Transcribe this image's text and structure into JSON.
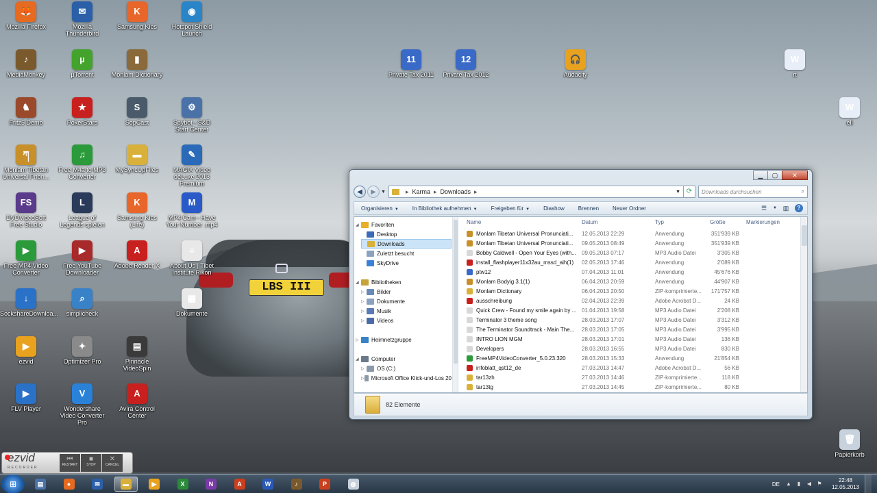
{
  "desktop": {
    "icons": [
      {
        "label": "Mozilla Firefox",
        "icon": "firefox-icon",
        "color": "#e66a1f",
        "glyph": "🦊"
      },
      {
        "label": "Mozilla Thunderbird",
        "icon": "thunderbird-icon",
        "color": "#2b5fa8",
        "glyph": "✉"
      },
      {
        "label": "Samsung Kies",
        "icon": "samsung-kies-icon",
        "color": "#e8662a",
        "glyph": "K"
      },
      {
        "label": "Hotspot Shield Launch",
        "icon": "hotspot-shield-icon",
        "color": "#2a84c8",
        "glyph": "◉"
      },
      {
        "label": "MediaMonkey",
        "icon": "mediamonkey-icon",
        "color": "#7a5a2c",
        "glyph": "♪"
      },
      {
        "label": "µTorrent",
        "icon": "utorrent-icon",
        "color": "#44a32c",
        "glyph": "µ"
      },
      {
        "label": "Monlam Dictionary",
        "icon": "monlam-dictionary-icon",
        "color": "#8a6a3a",
        "glyph": "▮"
      },
      {
        "label": "Fritz5 Demo",
        "icon": "fritz-icon",
        "color": "#9a4a2a",
        "glyph": "♞"
      },
      {
        "label": "PokerStars",
        "icon": "pokerstars-icon",
        "color": "#c8201e",
        "glyph": "★"
      },
      {
        "label": "SopCast",
        "icon": "sopcast-icon",
        "color": "#4a5a6a",
        "glyph": "S"
      },
      {
        "label": "Spybot - S&D Start Center",
        "icon": "spybot-icon",
        "color": "#4a72a8",
        "glyph": "⚙"
      },
      {
        "label": "Monlam Tibetan Universal Phon...",
        "icon": "monlam-tibetan-icon",
        "color": "#c8902a",
        "glyph": "ཀ"
      },
      {
        "label": "Free M4a to MP3 Converter",
        "icon": "m4a-converter-icon",
        "color": "#2a9a3a",
        "glyph": "♫"
      },
      {
        "label": "MySyncUpFiles",
        "icon": "folder-icon",
        "color": "#d9b13a",
        "glyph": "▬"
      },
      {
        "label": "MAGIX Video deLuxe 2013 Premium",
        "icon": "magix-icon",
        "color": "#2a6ab8",
        "glyph": "✎"
      },
      {
        "label": "DVDVideoSoft Free Studio",
        "icon": "dvdvideosoft-icon",
        "color": "#5a3a8a",
        "glyph": "FS"
      },
      {
        "label": "League of Legends spielen",
        "icon": "lol-icon",
        "color": "#2a3a5a",
        "glyph": "L"
      },
      {
        "label": "Samsung Kies (Lite)",
        "icon": "samsung-kies-lite-icon",
        "color": "#e8662a",
        "glyph": "K"
      },
      {
        "label": "MP4 Cam - Have Your Number .mp4",
        "icon": "mp4-file-icon",
        "color": "#2a5ac8",
        "glyph": "M"
      },
      {
        "label": "Free MP4 Video Converter",
        "icon": "mp4-converter-icon",
        "color": "#2a9a3a",
        "glyph": "▶"
      },
      {
        "label": "Free YouTube Downloader",
        "icon": "youtube-downloader-icon",
        "color": "#a82a2a",
        "glyph": "▶"
      },
      {
        "label": "Adobe Reader X",
        "icon": "adobe-reader-icon",
        "color": "#c8201e",
        "glyph": "A"
      },
      {
        "label": "About Us | Tibet Institute Rikon",
        "icon": "document-icon",
        "color": "#e8e8e8",
        "glyph": "≡"
      },
      {
        "label": "SockshareDownloa...",
        "icon": "sockshare-icon",
        "color": "#2a72c8",
        "glyph": "↓"
      },
      {
        "label": "simplicheck",
        "icon": "simplicheck-icon",
        "color": "#3a82c8",
        "glyph": "⌕"
      },
      {
        "label": "Dokumente",
        "icon": "dokumente-icon",
        "color": "#e8e8e8",
        "glyph": "▦"
      },
      {
        "label": "ezvid",
        "icon": "ezvid-icon",
        "color": "#e8a21e",
        "glyph": "▶"
      },
      {
        "label": "Optimizer Pro",
        "icon": "optimizer-icon",
        "color": "#8a8a8a",
        "glyph": "✦"
      },
      {
        "label": "Pinnacle VideoSpin",
        "icon": "pinnacle-icon",
        "color": "#3a3a3a",
        "glyph": "▤"
      },
      {
        "label": "FLV Player",
        "icon": "flv-player-icon",
        "color": "#2a72c8",
        "glyph": "▶"
      },
      {
        "label": "Wondershare Video Converter Pro",
        "icon": "wondershare-icon",
        "color": "#2a82d8",
        "glyph": "V"
      },
      {
        "label": "Avira Control Center",
        "icon": "avira-icon",
        "color": "#c8201e",
        "glyph": "A"
      },
      {
        "label": "Private Tax 2011",
        "icon": "private-tax-2011-icon",
        "color": "#3a6ac8",
        "glyph": "11"
      },
      {
        "label": "Private Tax 2012",
        "icon": "private-tax-2012-icon",
        "color": "#3a6ac8",
        "glyph": "12"
      },
      {
        "label": "Audacity",
        "icon": "audacity-icon",
        "color": "#e8a21e",
        "glyph": "🎧"
      },
      {
        "label": "rt",
        "icon": "word-doc-icon",
        "color": "#e8eef8",
        "glyph": "W"
      },
      {
        "label": "ell",
        "icon": "word-doc-icon",
        "color": "#e8eef8",
        "glyph": "W"
      },
      {
        "label": "Papierkorb",
        "icon": "recycle-bin-icon",
        "color": "#c8d2dc",
        "glyph": "🗑"
      }
    ]
  },
  "wallpaper": {
    "plate": "LBS III"
  },
  "explorer": {
    "breadcrumb": [
      "Karma",
      "Downloads"
    ],
    "search_placeholder": "Downloads durchsuchen",
    "toolbar": [
      {
        "label": "Organisieren",
        "dropdown": true
      },
      {
        "label": "In Bibliothek aufnehmen",
        "dropdown": true
      },
      {
        "label": "Freigeben für",
        "dropdown": true
      },
      {
        "label": "Diashow",
        "dropdown": false
      },
      {
        "label": "Brennen",
        "dropdown": false
      },
      {
        "label": "Neuer Ordner",
        "dropdown": false
      }
    ],
    "nav": [
      {
        "label": "Favoriten",
        "level": 0,
        "expand": true,
        "color": "#e8b02a"
      },
      {
        "label": "Desktop",
        "level": 1,
        "color": "#3a6ab8"
      },
      {
        "label": "Downloads",
        "level": 1,
        "color": "#d9b13a",
        "selected": true
      },
      {
        "label": "Zuletzt besucht",
        "level": 1,
        "color": "#8aa2c0"
      },
      {
        "label": "SkyDrive",
        "level": 1,
        "color": "#3a82d8"
      },
      {
        "label": "",
        "level": 0,
        "spacer": true
      },
      {
        "label": "Bibliotheken",
        "level": 0,
        "expand": true,
        "color": "#c8a23a"
      },
      {
        "label": "Bilder",
        "level": 1,
        "collapsed": true,
        "color": "#6a8ab8"
      },
      {
        "label": "Dokumente",
        "level": 1,
        "collapsed": true,
        "color": "#8aa2c0"
      },
      {
        "label": "Musik",
        "level": 1,
        "collapsed": true,
        "color": "#5a7ab8"
      },
      {
        "label": "Videos",
        "level": 1,
        "collapsed": true,
        "color": "#4a6aa8"
      },
      {
        "label": "",
        "level": 0,
        "spacer": true
      },
      {
        "label": "Heimnetzgruppe",
        "level": 0,
        "collapsed": true,
        "color": "#3a82c8"
      },
      {
        "label": "",
        "level": 0,
        "spacer": true
      },
      {
        "label": "Computer",
        "level": 0,
        "expand": true,
        "color": "#6a7a8a"
      },
      {
        "label": "OS (C:)",
        "level": 1,
        "collapsed": true,
        "color": "#8a9aaa"
      },
      {
        "label": "Microsoft Office Klick-und-Los 20",
        "level": 1,
        "collapsed": true,
        "color": "#8a9aaa"
      }
    ],
    "columns": [
      "Name",
      "Datum",
      "Typ",
      "Größe",
      "Markierungen"
    ],
    "files": [
      {
        "name": "Monlam Tibetan Universal Pronunciati...",
        "date": "12.05.2013 22:29",
        "type": "Anwendung",
        "size": "351'939 KB",
        "color": "#c8902a"
      },
      {
        "name": "Monlam Tibetan Universal Pronunciati...",
        "date": "09.05.2013 08:49",
        "type": "Anwendung",
        "size": "351'939 KB",
        "color": "#c8902a"
      },
      {
        "name": "Bobby Caldwell - Open Your Eyes (with...",
        "date": "09.05.2013 07:17",
        "type": "MP3 Audio Datei",
        "size": "3'305 KB",
        "color": "#d8d8d8"
      },
      {
        "name": "install_flashplayer11x32au_mssd_aih(1)",
        "date": "02.05.2013 17:46",
        "type": "Anwendung",
        "size": "2'089 KB",
        "color": "#c8201e"
      },
      {
        "name": "ptw12",
        "date": "07.04.2013 11:01",
        "type": "Anwendung",
        "size": "45'676 KB",
        "color": "#3a6ac8"
      },
      {
        "name": "Monlam Bodyig 3.1(1)",
        "date": "06.04.2013 20:59",
        "type": "Anwendung",
        "size": "44'907 KB",
        "color": "#c8902a"
      },
      {
        "name": "Monlam Dictionary",
        "date": "06.04.2013 20:50",
        "type": "ZIP-komprimierte...",
        "size": "171'757 KB",
        "color": "#d9b13a"
      },
      {
        "name": "ausschreibung",
        "date": "02.04.2013 22:39",
        "type": "Adobe Acrobat D...",
        "size": "24 KB",
        "color": "#c8201e"
      },
      {
        "name": "Quick Crew - Found my smile again by ...",
        "date": "01.04.2013 19:58",
        "type": "MP3 Audio Datei",
        "size": "2'208 KB",
        "color": "#d8d8d8"
      },
      {
        "name": "Terminator 3 theme song",
        "date": "28.03.2013 17:07",
        "type": "MP3 Audio Datei",
        "size": "3'312 KB",
        "color": "#d8d8d8"
      },
      {
        "name": "The Terminator Soundtrack - Main The...",
        "date": "28.03.2013 17:05",
        "type": "MP3 Audio Datei",
        "size": "3'995 KB",
        "color": "#d8d8d8"
      },
      {
        "name": "INTRO LION MGM",
        "date": "28.03.2013 17:01",
        "type": "MP3 Audio Datei",
        "size": "136 KB",
        "color": "#d8d8d8"
      },
      {
        "name": "Developers",
        "date": "28.03.2013 16:55",
        "type": "MP3 Audio Datei",
        "size": "830 KB",
        "color": "#d8d8d8"
      },
      {
        "name": "FreeMP4VideoConverter_5.0.23.320",
        "date": "28.03.2013 15:33",
        "type": "Anwendung",
        "size": "21'854 KB",
        "color": "#2a9a3a"
      },
      {
        "name": "infoblatt_qst12_de",
        "date": "27.03.2013 14:47",
        "type": "Adobe Acrobat D...",
        "size": "56 KB",
        "color": "#c8201e"
      },
      {
        "name": "tar13zh",
        "date": "27.03.2013 14:46",
        "type": "ZIP-komprimierte...",
        "size": "118 KB",
        "color": "#d9b13a"
      },
      {
        "name": "tar13tg",
        "date": "27.03.2013 14:45",
        "type": "ZIP-komprimierte...",
        "size": "80 KB",
        "color": "#d9b13a"
      }
    ],
    "status": "82 Elemente"
  },
  "ezvid": {
    "logo": "ezvid",
    "logo_sub": "RECORDER",
    "buttons": [
      "RESTART",
      "STOP",
      "CANCEL"
    ]
  },
  "taskbar": {
    "items": [
      {
        "icon": "file-manager-icon",
        "color": "#4a72a8",
        "glyph": "▤"
      },
      {
        "icon": "firefox-icon",
        "color": "#e66a1f",
        "glyph": "●"
      },
      {
        "icon": "thunderbird-icon",
        "color": "#2b5fa8",
        "glyph": "✉"
      },
      {
        "icon": "explorer-icon",
        "color": "#d9b13a",
        "glyph": "▬",
        "active": true
      },
      {
        "icon": "media-player-icon",
        "color": "#e8a21e",
        "glyph": "▶"
      },
      {
        "icon": "excel-icon",
        "color": "#2a8a3a",
        "glyph": "X"
      },
      {
        "icon": "onenote-icon",
        "color": "#7a3aa8",
        "glyph": "N"
      },
      {
        "icon": "access-icon",
        "color": "#c8401e",
        "glyph": "A"
      },
      {
        "icon": "word-icon",
        "color": "#2a5ab8",
        "glyph": "W"
      },
      {
        "icon": "mediamonkey-icon",
        "color": "#7a5a2c",
        "glyph": "♪"
      },
      {
        "icon": "powerpoint-icon",
        "color": "#c8401e",
        "glyph": "P"
      },
      {
        "icon": "app-icon",
        "color": "#c8d2dc",
        "glyph": "◍"
      }
    ],
    "lang": "DE",
    "time": "22:48",
    "date": "12.05.2013"
  }
}
